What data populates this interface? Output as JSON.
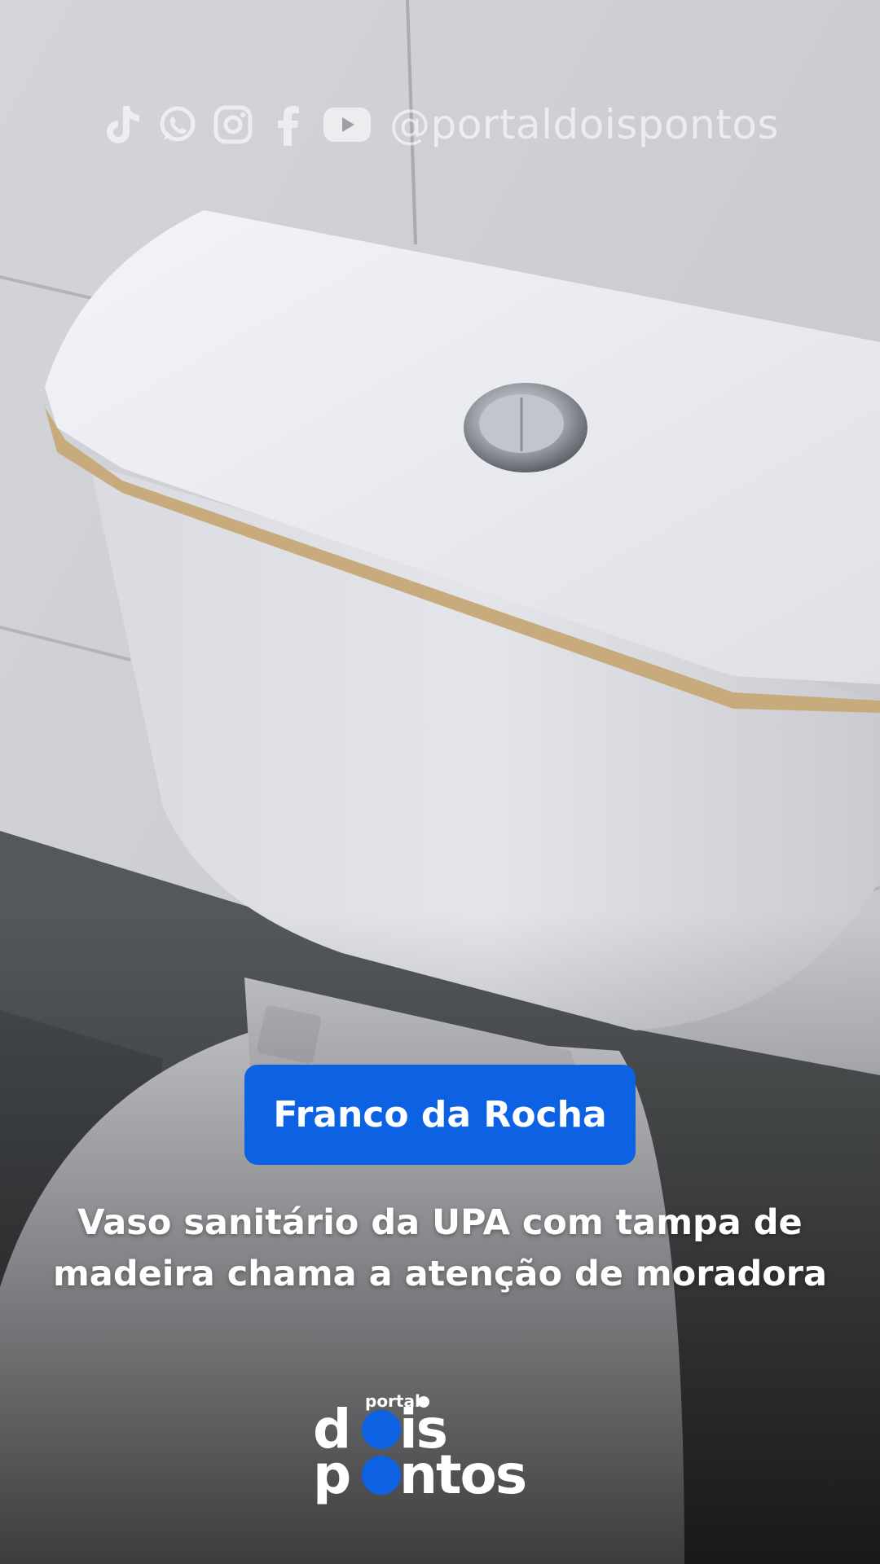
{
  "social": {
    "icons": [
      "tiktok-icon",
      "whatsapp-icon",
      "instagram-icon",
      "facebook-icon",
      "youtube-icon"
    ],
    "handle": "@portaldoispontos"
  },
  "tag": {
    "label": "Franco da Rocha",
    "color": "#0c62e2"
  },
  "headline": "Vaso sanitário da UPA com tampa de madeira chama a atenção de moradora",
  "logo": {
    "small_word": "portal",
    "line1": "dois",
    "line2": "pontos",
    "accent": "#0c62e2"
  }
}
